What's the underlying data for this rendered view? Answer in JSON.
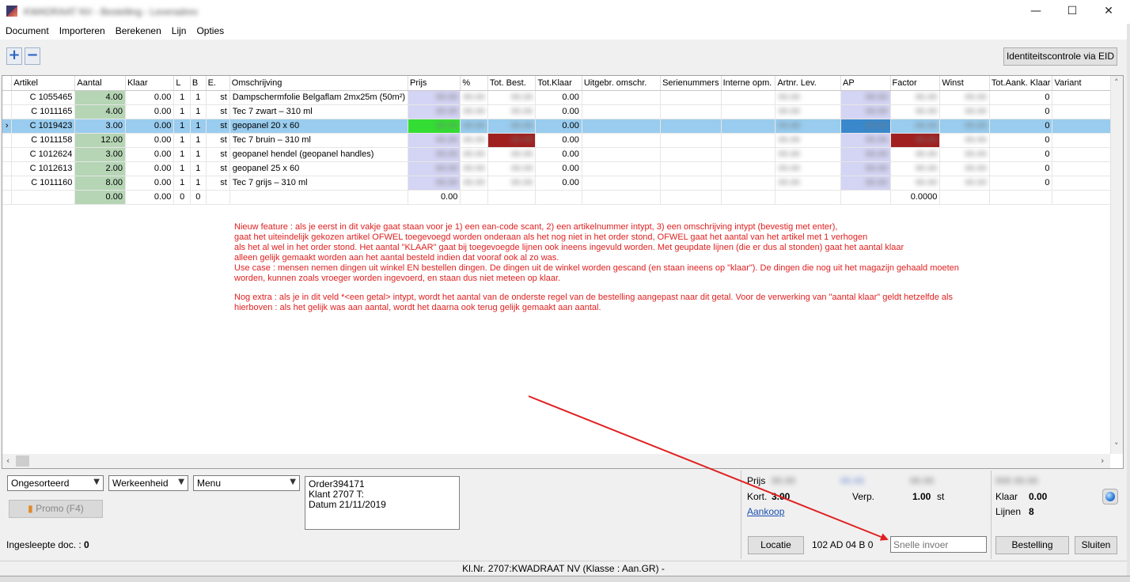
{
  "window": {
    "title": "KWADRAAT NV - Bestelling - Leveradres",
    "controls": [
      "—",
      "☐",
      "✕"
    ]
  },
  "menu": [
    "Document",
    "Importeren",
    "Berekenen",
    "Lijn",
    "Opties"
  ],
  "toolbar": {
    "add_symbol": "+",
    "remove_symbol": "−",
    "eid_button": "Identiteitscontrole via EID"
  },
  "grid": {
    "columns": [
      "Artikel",
      "Aantal",
      "Klaar",
      "L",
      "B",
      "E.",
      "Omschrijving",
      "Prijs",
      "%",
      "Tot. Best.",
      "Tot.Klaar",
      "Uitgebr. omschr.",
      "Serienummers",
      "Interne opm.",
      "Artnr. Lev.",
      "AP",
      "Factor",
      "Winst",
      "Tot.Aank. Klaar",
      "Variant"
    ],
    "rows": [
      {
        "artikel": "C 1055465",
        "aantal": "4.00",
        "klaar": "0.00",
        "l": "1",
        "b": "1",
        "e": "st",
        "omschrijving": "Dampschermfolie Belgaflam 2mx25m (50m²)",
        "tot_klaar": "0.00",
        "tot_aank": "0",
        "selected": false
      },
      {
        "artikel": "C 1011165",
        "aantal": "4.00",
        "klaar": "0.00",
        "l": "1",
        "b": "1",
        "e": "st",
        "omschrijving": "Tec 7 zwart – 310 ml",
        "tot_klaar": "0.00",
        "tot_aank": "0",
        "selected": false
      },
      {
        "artikel": "C 1019423",
        "aantal": "3.00",
        "klaar": "0.00",
        "l": "1",
        "b": "1",
        "e": "st",
        "omschrijving": "geopanel 20 x 60",
        "tot_klaar": "0.00",
        "tot_aank": "0",
        "selected": true
      },
      {
        "artikel": "C 1011158",
        "aantal": "12.00",
        "klaar": "0.00",
        "l": "1",
        "b": "1",
        "e": "st",
        "omschrijving": "Tec 7 bruin – 310 ml",
        "tot_klaar": "0.00",
        "tot_aank": "0",
        "selected": false
      },
      {
        "artikel": "C 1012624",
        "aantal": "3.00",
        "klaar": "0.00",
        "l": "1",
        "b": "1",
        "e": "st",
        "omschrijving": "geopanel hendel (geopanel handles)",
        "tot_klaar": "0.00",
        "tot_aank": "0",
        "selected": false
      },
      {
        "artikel": "C 1012613",
        "aantal": "2.00",
        "klaar": "0.00",
        "l": "1",
        "b": "1",
        "e": "st",
        "omschrijving": "geopanel 25 x 60",
        "tot_klaar": "0.00",
        "tot_aank": "0",
        "selected": false
      },
      {
        "artikel": "C 1011160",
        "aantal": "8.00",
        "klaar": "0.00",
        "l": "1",
        "b": "1",
        "e": "st",
        "omschrijving": "Tec 7 grijs – 310 ml",
        "tot_klaar": "0.00",
        "tot_aank": "0",
        "selected": false
      }
    ],
    "empty_row": {
      "aantal": "0.00",
      "klaar": "0.00",
      "l": "0",
      "b": "0",
      "prijs": "0.00",
      "factor": "0.0000"
    },
    "selected_marker": "›"
  },
  "annotation": {
    "paragraph1": "Nieuw feature : als je eerst in dit vakje gaat staan voor je 1) een ean-code scant, 2) een artikelnummer intypt, 3) een omschrijving intypt (bevestig met enter),\ngaat het uiteindelijk gekozen artikel OFWEL toegevoegd worden onderaan als het nog niet in het order stond, OFWEL gaat het aantal van het artikel met 1 verhogen\nals het al wel in het order stond. Het aantal \"KLAAR\" gaat bij toegevoegde lijnen ook ineens ingevuld worden. Met geupdate lijnen (die er dus al stonden) gaat het aantal klaar\nalleen gelijk gemaakt worden aan het aantal besteld indien dat vooraf ook al zo was.\nUse case : mensen nemen dingen uit winkel EN bestellen dingen. De dingen uit de winkel worden gescand (en staan ineens op \"klaar\"). De dingen die nog uit het magazijn gehaald moeten\nworden, kunnen zoals vroeger worden ingevoerd, en staan dus niet meteen op klaar.",
    "paragraph2": "Nog extra : als je in dit veld *<een getal> intypt, wordt het aantal van de onderste regel van de bestelling aangepast naar dit getal. Voor de verwerking van \"aantal klaar\" geldt hetzelfde als\nhierboven : als het gelijk was aan aantal, wordt het daarna ook terug gelijk gemaakt aan aantal."
  },
  "bottom": {
    "sort_select": "Ongesorteerd",
    "unit_select": "Werkeenheid",
    "menu_select": "Menu",
    "promo_button": "Promo (F4)",
    "ingesleepte_label": "Ingesleepte doc. :",
    "ingesleepte_value": "0",
    "order_lines": [
      "Order394171",
      "Klant 2707  T:",
      "Datum 21/11/2019"
    ],
    "prijs_label": "Prijs",
    "kort_label": "Kort.",
    "kort_value": "3.00",
    "verp_label": "Verp.",
    "verp_value": "1.00",
    "verp_unit": "st",
    "aankoop_link": "Aankoop",
    "locatie_button": "Locatie",
    "location_text": "102  AD 04 B 0",
    "snelle_placeholder": "Snelle invoer",
    "klaar_label": "Klaar",
    "klaar_value": "0.00",
    "lijnen_label": "Lijnen",
    "lijnen_value": "8",
    "bestelling_button": "Bestelling",
    "sluiten_button": "Sluiten"
  },
  "statusbar": {
    "text": "Kl.Nr. 2707:KWADRAAT NV (Klasse : Aan.GR) -"
  },
  "colors": {
    "annotation": "#e02020",
    "selected_row": "#99ccee",
    "aantal_cell": "#b5d5b5",
    "prijs_cell": "#d4d4f4",
    "arrow": "#e02020"
  }
}
